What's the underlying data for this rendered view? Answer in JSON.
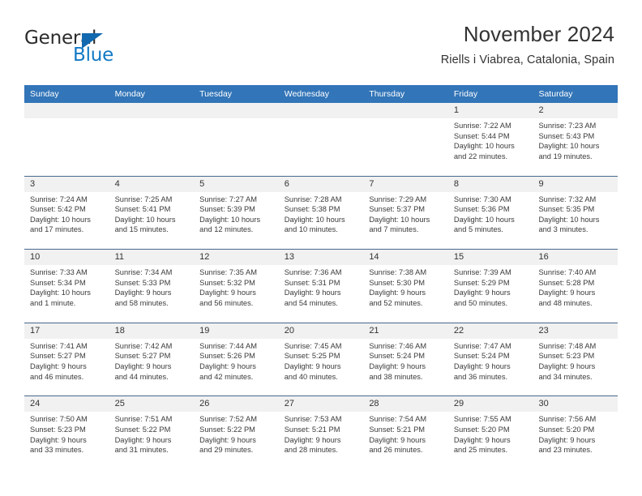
{
  "brand": {
    "name_top": "General",
    "name_bottom": "Blue",
    "triangle_color": "#1269b0",
    "blue_text_color": "#1179c4"
  },
  "header": {
    "title": "November 2024",
    "subtitle": "Riells i Viabrea, Catalonia, Spain"
  },
  "theme": {
    "header_blue": "#3275b8",
    "row_divider": "#46688d",
    "day_band_gray": "#f1f1f1"
  },
  "weekdays": [
    "Sunday",
    "Monday",
    "Tuesday",
    "Wednesday",
    "Thursday",
    "Friday",
    "Saturday"
  ],
  "weeks": [
    [
      {
        "day": "",
        "sunrise": "",
        "sunset": "",
        "daylight1": "",
        "daylight2": ""
      },
      {
        "day": "",
        "sunrise": "",
        "sunset": "",
        "daylight1": "",
        "daylight2": ""
      },
      {
        "day": "",
        "sunrise": "",
        "sunset": "",
        "daylight1": "",
        "daylight2": ""
      },
      {
        "day": "",
        "sunrise": "",
        "sunset": "",
        "daylight1": "",
        "daylight2": ""
      },
      {
        "day": "",
        "sunrise": "",
        "sunset": "",
        "daylight1": "",
        "daylight2": ""
      },
      {
        "day": "1",
        "sunrise": "Sunrise: 7:22 AM",
        "sunset": "Sunset: 5:44 PM",
        "daylight1": "Daylight: 10 hours",
        "daylight2": "and 22 minutes."
      },
      {
        "day": "2",
        "sunrise": "Sunrise: 7:23 AM",
        "sunset": "Sunset: 5:43 PM",
        "daylight1": "Daylight: 10 hours",
        "daylight2": "and 19 minutes."
      }
    ],
    [
      {
        "day": "3",
        "sunrise": "Sunrise: 7:24 AM",
        "sunset": "Sunset: 5:42 PM",
        "daylight1": "Daylight: 10 hours",
        "daylight2": "and 17 minutes."
      },
      {
        "day": "4",
        "sunrise": "Sunrise: 7:25 AM",
        "sunset": "Sunset: 5:41 PM",
        "daylight1": "Daylight: 10 hours",
        "daylight2": "and 15 minutes."
      },
      {
        "day": "5",
        "sunrise": "Sunrise: 7:27 AM",
        "sunset": "Sunset: 5:39 PM",
        "daylight1": "Daylight: 10 hours",
        "daylight2": "and 12 minutes."
      },
      {
        "day": "6",
        "sunrise": "Sunrise: 7:28 AM",
        "sunset": "Sunset: 5:38 PM",
        "daylight1": "Daylight: 10 hours",
        "daylight2": "and 10 minutes."
      },
      {
        "day": "7",
        "sunrise": "Sunrise: 7:29 AM",
        "sunset": "Sunset: 5:37 PM",
        "daylight1": "Daylight: 10 hours",
        "daylight2": "and 7 minutes."
      },
      {
        "day": "8",
        "sunrise": "Sunrise: 7:30 AM",
        "sunset": "Sunset: 5:36 PM",
        "daylight1": "Daylight: 10 hours",
        "daylight2": "and 5 minutes."
      },
      {
        "day": "9",
        "sunrise": "Sunrise: 7:32 AM",
        "sunset": "Sunset: 5:35 PM",
        "daylight1": "Daylight: 10 hours",
        "daylight2": "and 3 minutes."
      }
    ],
    [
      {
        "day": "10",
        "sunrise": "Sunrise: 7:33 AM",
        "sunset": "Sunset: 5:34 PM",
        "daylight1": "Daylight: 10 hours",
        "daylight2": "and 1 minute."
      },
      {
        "day": "11",
        "sunrise": "Sunrise: 7:34 AM",
        "sunset": "Sunset: 5:33 PM",
        "daylight1": "Daylight: 9 hours",
        "daylight2": "and 58 minutes."
      },
      {
        "day": "12",
        "sunrise": "Sunrise: 7:35 AM",
        "sunset": "Sunset: 5:32 PM",
        "daylight1": "Daylight: 9 hours",
        "daylight2": "and 56 minutes."
      },
      {
        "day": "13",
        "sunrise": "Sunrise: 7:36 AM",
        "sunset": "Sunset: 5:31 PM",
        "daylight1": "Daylight: 9 hours",
        "daylight2": "and 54 minutes."
      },
      {
        "day": "14",
        "sunrise": "Sunrise: 7:38 AM",
        "sunset": "Sunset: 5:30 PM",
        "daylight1": "Daylight: 9 hours",
        "daylight2": "and 52 minutes."
      },
      {
        "day": "15",
        "sunrise": "Sunrise: 7:39 AM",
        "sunset": "Sunset: 5:29 PM",
        "daylight1": "Daylight: 9 hours",
        "daylight2": "and 50 minutes."
      },
      {
        "day": "16",
        "sunrise": "Sunrise: 7:40 AM",
        "sunset": "Sunset: 5:28 PM",
        "daylight1": "Daylight: 9 hours",
        "daylight2": "and 48 minutes."
      }
    ],
    [
      {
        "day": "17",
        "sunrise": "Sunrise: 7:41 AM",
        "sunset": "Sunset: 5:27 PM",
        "daylight1": "Daylight: 9 hours",
        "daylight2": "and 46 minutes."
      },
      {
        "day": "18",
        "sunrise": "Sunrise: 7:42 AM",
        "sunset": "Sunset: 5:27 PM",
        "daylight1": "Daylight: 9 hours",
        "daylight2": "and 44 minutes."
      },
      {
        "day": "19",
        "sunrise": "Sunrise: 7:44 AM",
        "sunset": "Sunset: 5:26 PM",
        "daylight1": "Daylight: 9 hours",
        "daylight2": "and 42 minutes."
      },
      {
        "day": "20",
        "sunrise": "Sunrise: 7:45 AM",
        "sunset": "Sunset: 5:25 PM",
        "daylight1": "Daylight: 9 hours",
        "daylight2": "and 40 minutes."
      },
      {
        "day": "21",
        "sunrise": "Sunrise: 7:46 AM",
        "sunset": "Sunset: 5:24 PM",
        "daylight1": "Daylight: 9 hours",
        "daylight2": "and 38 minutes."
      },
      {
        "day": "22",
        "sunrise": "Sunrise: 7:47 AM",
        "sunset": "Sunset: 5:24 PM",
        "daylight1": "Daylight: 9 hours",
        "daylight2": "and 36 minutes."
      },
      {
        "day": "23",
        "sunrise": "Sunrise: 7:48 AM",
        "sunset": "Sunset: 5:23 PM",
        "daylight1": "Daylight: 9 hours",
        "daylight2": "and 34 minutes."
      }
    ],
    [
      {
        "day": "24",
        "sunrise": "Sunrise: 7:50 AM",
        "sunset": "Sunset: 5:23 PM",
        "daylight1": "Daylight: 9 hours",
        "daylight2": "and 33 minutes."
      },
      {
        "day": "25",
        "sunrise": "Sunrise: 7:51 AM",
        "sunset": "Sunset: 5:22 PM",
        "daylight1": "Daylight: 9 hours",
        "daylight2": "and 31 minutes."
      },
      {
        "day": "26",
        "sunrise": "Sunrise: 7:52 AM",
        "sunset": "Sunset: 5:22 PM",
        "daylight1": "Daylight: 9 hours",
        "daylight2": "and 29 minutes."
      },
      {
        "day": "27",
        "sunrise": "Sunrise: 7:53 AM",
        "sunset": "Sunset: 5:21 PM",
        "daylight1": "Daylight: 9 hours",
        "daylight2": "and 28 minutes."
      },
      {
        "day": "28",
        "sunrise": "Sunrise: 7:54 AM",
        "sunset": "Sunset: 5:21 PM",
        "daylight1": "Daylight: 9 hours",
        "daylight2": "and 26 minutes."
      },
      {
        "day": "29",
        "sunrise": "Sunrise: 7:55 AM",
        "sunset": "Sunset: 5:20 PM",
        "daylight1": "Daylight: 9 hours",
        "daylight2": "and 25 minutes."
      },
      {
        "day": "30",
        "sunrise": "Sunrise: 7:56 AM",
        "sunset": "Sunset: 5:20 PM",
        "daylight1": "Daylight: 9 hours",
        "daylight2": "and 23 minutes."
      }
    ]
  ]
}
